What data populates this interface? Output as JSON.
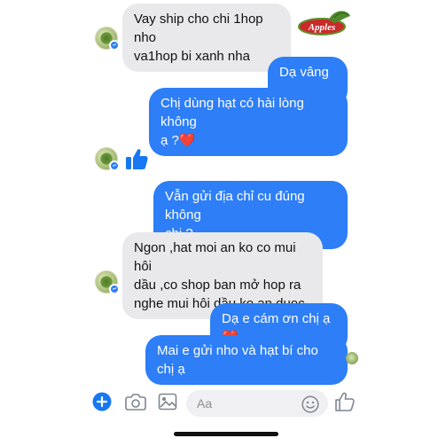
{
  "conversation": {
    "messages": [
      {
        "from": "contact",
        "text": "Vay ship cho chi 1hop nho\nva1hop bi xanh nha"
      },
      {
        "from": "me",
        "text": "Dạ vâng ạ"
      },
      {
        "from": "me",
        "text": "Chị dùng hạt có hài lòng không\nạ ?❤️"
      },
      {
        "from": "contact",
        "type": "like"
      },
      {
        "from": "me",
        "text": "Vẫn gửi địa chỉ cu đúng không\nchị ?"
      },
      {
        "from": "contact",
        "text": "Ngon ,hat moi an ko co mui hôi\ndầu ,co shop ban mở hop ra\nnghe mui hôi dầu ko an duoc"
      },
      {
        "from": "me",
        "text": "Dạ e cám ơn chị ạ❤️"
      },
      {
        "from": "me",
        "text": "Mai e gửi nho và hạt bí cho chị ạ"
      }
    ]
  },
  "logo": {
    "text": "Apples"
  },
  "composer": {
    "placeholder": "Aa",
    "icons": [
      "plus-icon",
      "camera-icon",
      "image-icon",
      "emoji-icon",
      "thumbs-up-icon"
    ]
  },
  "colors": {
    "outgoing_bubble": "#2d7ef7",
    "incoming_bubble": "#e9e9eb",
    "accent": "#1877f2"
  }
}
